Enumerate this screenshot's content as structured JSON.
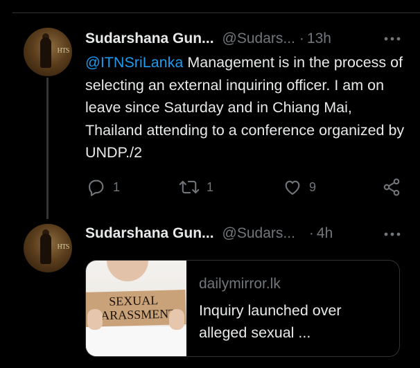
{
  "tweets": [
    {
      "name": "Sudarshana Gun...",
      "handle": "@Sudars...",
      "dot": "·",
      "time": "13h",
      "mention": "@ITNSriLanka",
      "text": "Management is in the process of selecting an external inquiring officer. I am on leave since Saturday and in Chiang Mai, Thailand attending to a conference organized by UNDP./2",
      "actions": {
        "replies": "1",
        "retweets": "1",
        "likes": "9"
      },
      "avatar_bg_text": "HTS"
    },
    {
      "name": "Sudarshana Gun...",
      "handle": "@Sudars...",
      "dot": "·",
      "time": "4h",
      "avatar_bg_text": "HTS",
      "card": {
        "image_text_line1": "SEXUAL",
        "image_text_line2": "HARASSMENT",
        "domain": "dailymirror.lk",
        "title": "Inquiry launched over alleged sexual ..."
      }
    }
  ],
  "colors": {
    "background": "#000000",
    "text": "#e7e9ea",
    "secondary": "#71767b",
    "link": "#1d9bf0",
    "border": "#2f3336"
  }
}
